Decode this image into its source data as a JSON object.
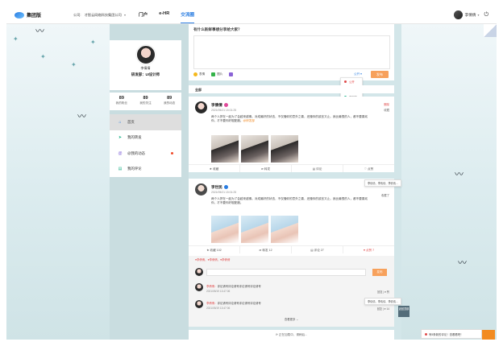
{
  "header": {
    "logo_text": "集团版",
    "company_label": "公司:",
    "company_name": "才智云网络科技集团公司",
    "nav": [
      {
        "label": "门户"
      },
      {
        "label": "e-HR"
      },
      {
        "label": "交流圈"
      }
    ],
    "user_name": "李倩倩"
  },
  "profile": {
    "name": "李倩倩",
    "title": "研发部：UI设计师",
    "stats": [
      {
        "value": "89",
        "label": "我的粉丝"
      },
      {
        "value": "89",
        "label": "我的关注"
      },
      {
        "value": "89",
        "label": "我的动态"
      }
    ]
  },
  "menu": [
    {
      "label": "首页",
      "icon": "home-icon"
    },
    {
      "label": "我的转发",
      "icon": "share-icon"
    },
    {
      "label": "@我的动态",
      "icon": "at-icon"
    },
    {
      "label": "我的评论",
      "icon": "comment-icon"
    }
  ],
  "post_box": {
    "title": "有什么新鲜事想分享给大家？",
    "tools": [
      "表情",
      "图片",
      ""
    ],
    "visibility": "公开",
    "publish": "发布",
    "visibility_options": [
      "公开",
      "仅个人",
      "仅好友",
      "仅部门",
      "仅公司"
    ]
  },
  "feed_tab": "全部",
  "posts": [
    {
      "name": "李倩倩",
      "time": "2021/05/21 15:01:25",
      "body": "两个人拼在一起为了会越来越像。对成最好的状态，不仅懂你的意外之喜，还懂你的欲言又止。我比最恨的人，都不要喜欢你，才不要你好粗配副。",
      "tag": "@研发部",
      "side1": "删除",
      "side2": "收藏",
      "actions": [
        "收藏",
        "转发",
        "评论",
        "点赞"
      ]
    },
    {
      "name": "李世民",
      "time": "2021/05/21 15:01:25",
      "body": "两个人拼在一起为了会越来越像。对成最好的状态，不仅懂你的意外之喜，还懂你的欲言又止。我比最恨的人，都不要喜欢你，才不要你好粗配副。",
      "side2": "收藏了",
      "actions": [
        "收藏 102",
        "转发 12",
        "评论 27",
        "点赞 7"
      ]
    }
  ],
  "comments": {
    "likers": "♥李倩倩、♥李倩倩、♥李倩倩",
    "send": "发布",
    "items": [
      {
        "name": "李倩倩：",
        "text": "评论请号评论请号评论请号评论请号",
        "time": "2021/05/19 13:47:06",
        "ops": "回复 | ♥ 赞"
      },
      {
        "name": "李倩倩：",
        "text": "评论请号评论请号评论请号评论请号",
        "time": "2021/05/19 13:47:06",
        "ops": "回复 | ♥ 14"
      }
    ],
    "more": "查看更多 ⌄"
  },
  "loading": "正在加载中，请稍后...",
  "tooltips": [
    "李倩倩、李倩倩、李倩倩...",
    "李倩倩、李倩倩、李倩倩..."
  ],
  "side_button": "返回顶部",
  "notice": "有5条新的评论！查看看吧！",
  "colors": {
    "accent": "#2a7de1",
    "publish": "#f7a15c",
    "like": "#e04a4a"
  }
}
